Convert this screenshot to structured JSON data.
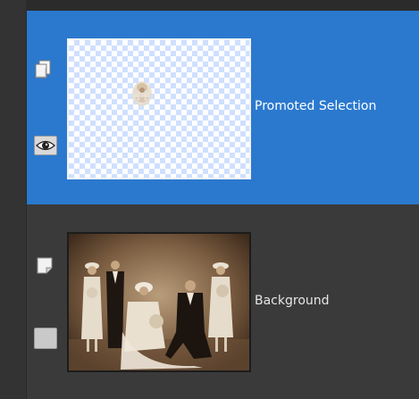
{
  "layers": [
    {
      "name": "Promoted Selection",
      "selected": true,
      "visible": true,
      "layer_type_icon": "raster-layer-icon",
      "visibility_icon": "eye-icon",
      "thumbnail": "transparent-thumbnail-with-bride-cutout"
    },
    {
      "name": "Background",
      "selected": false,
      "visible": true,
      "layer_type_icon": "background-layer-icon",
      "visibility_icon": "visibility-toggle-icon",
      "thumbnail": "sepia-wedding-photo-thumbnail"
    }
  ],
  "colors": {
    "panel_bg": "#3a3a3a",
    "selected_bg": "#2b79cf",
    "selected_text": "#ffffff",
    "normal_text": "#e6e6e6",
    "gutter": "#333333"
  }
}
